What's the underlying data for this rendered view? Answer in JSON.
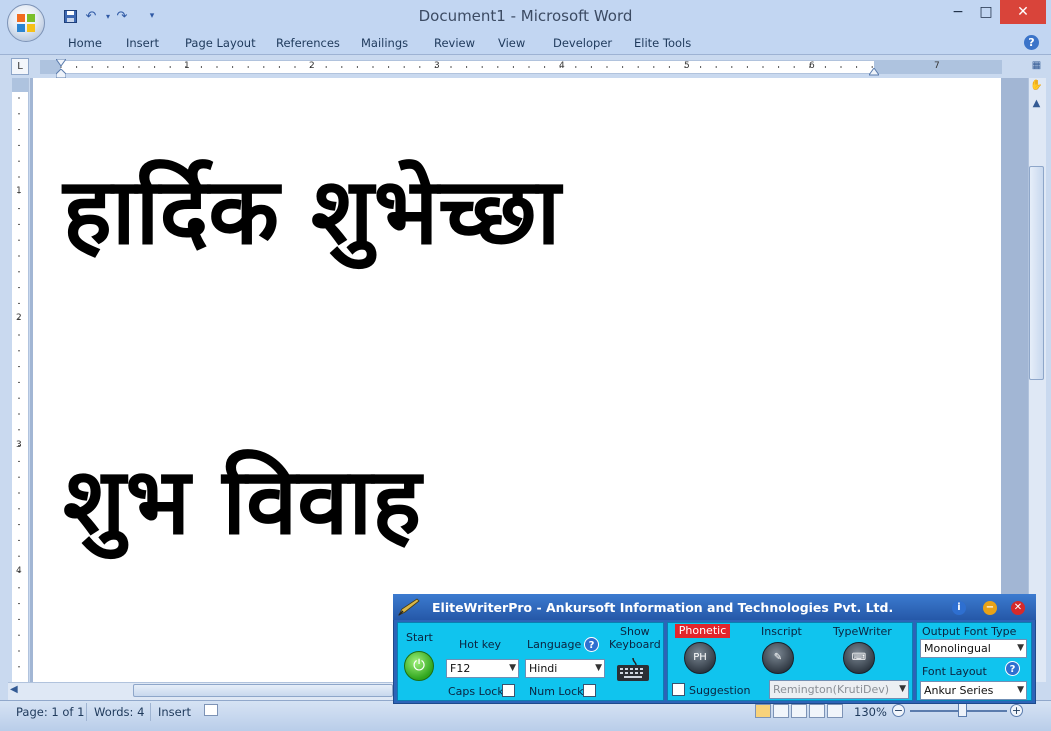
{
  "window": {
    "title": "Document1 - Microsoft Word",
    "minimize": "−",
    "maximize": "□",
    "close": "✕"
  },
  "qat": {
    "save_icon": "save-icon",
    "undo_icon": "undo-icon",
    "redo_icon": "redo-icon",
    "customize_icon": "customize-icon"
  },
  "ribbon": {
    "tabs": [
      "Home",
      "Insert",
      "Page Layout",
      "References",
      "Mailings",
      "Review",
      "View",
      "Developer",
      "Elite Tools"
    ],
    "help": "?"
  },
  "ruler": {
    "tab_selector": "L",
    "h_numbers": [
      "1",
      "2",
      "3",
      "4",
      "5",
      "6",
      "7"
    ],
    "v_numbers": [
      "1",
      "2",
      "3",
      "4"
    ]
  },
  "document": {
    "line1": "हार्दिक शुभेच्छा",
    "line2": "शुभ विवाह"
  },
  "statusbar": {
    "page": "Page: 1 of 1",
    "words": "Words: 4",
    "mode": "Insert",
    "zoom": "130%",
    "zoom_minus": "−",
    "zoom_plus": "+",
    "zoom_level": 0.55
  },
  "elitewriter": {
    "title": "EliteWriterPro - Ankursoft Information and Technologies Pvt. Ltd.",
    "info_btn": "i",
    "minimize_btn": "−",
    "close_btn": "✕",
    "start_label": "Start",
    "hotkey_label": "Hot key",
    "hotkey_value": "F12",
    "language_label": "Language",
    "language_value": "Hindi",
    "help": "?",
    "show_keyboard_line1": "Show",
    "show_keyboard_line2": "Keyboard",
    "caps_lock_label": "Caps Lock",
    "num_lock_label": "Num Lock",
    "modes": {
      "phonetic": "Phonetic",
      "inscript": "Inscript",
      "typewriter": "TypeWriter"
    },
    "suggestion_label": "Suggestion",
    "typewriter_layout": "Remington(KrutiDev)",
    "output_font_type_label": "Output  Font  Type",
    "output_font_type_value": "Monolingual",
    "font_layout_label": "Font Layout",
    "font_layout_value": "Ankur Series",
    "colors": {
      "panel_bg": "#2c64b8",
      "section_bg": "#10c4ee",
      "phonetic_active": "#e2252b"
    }
  }
}
